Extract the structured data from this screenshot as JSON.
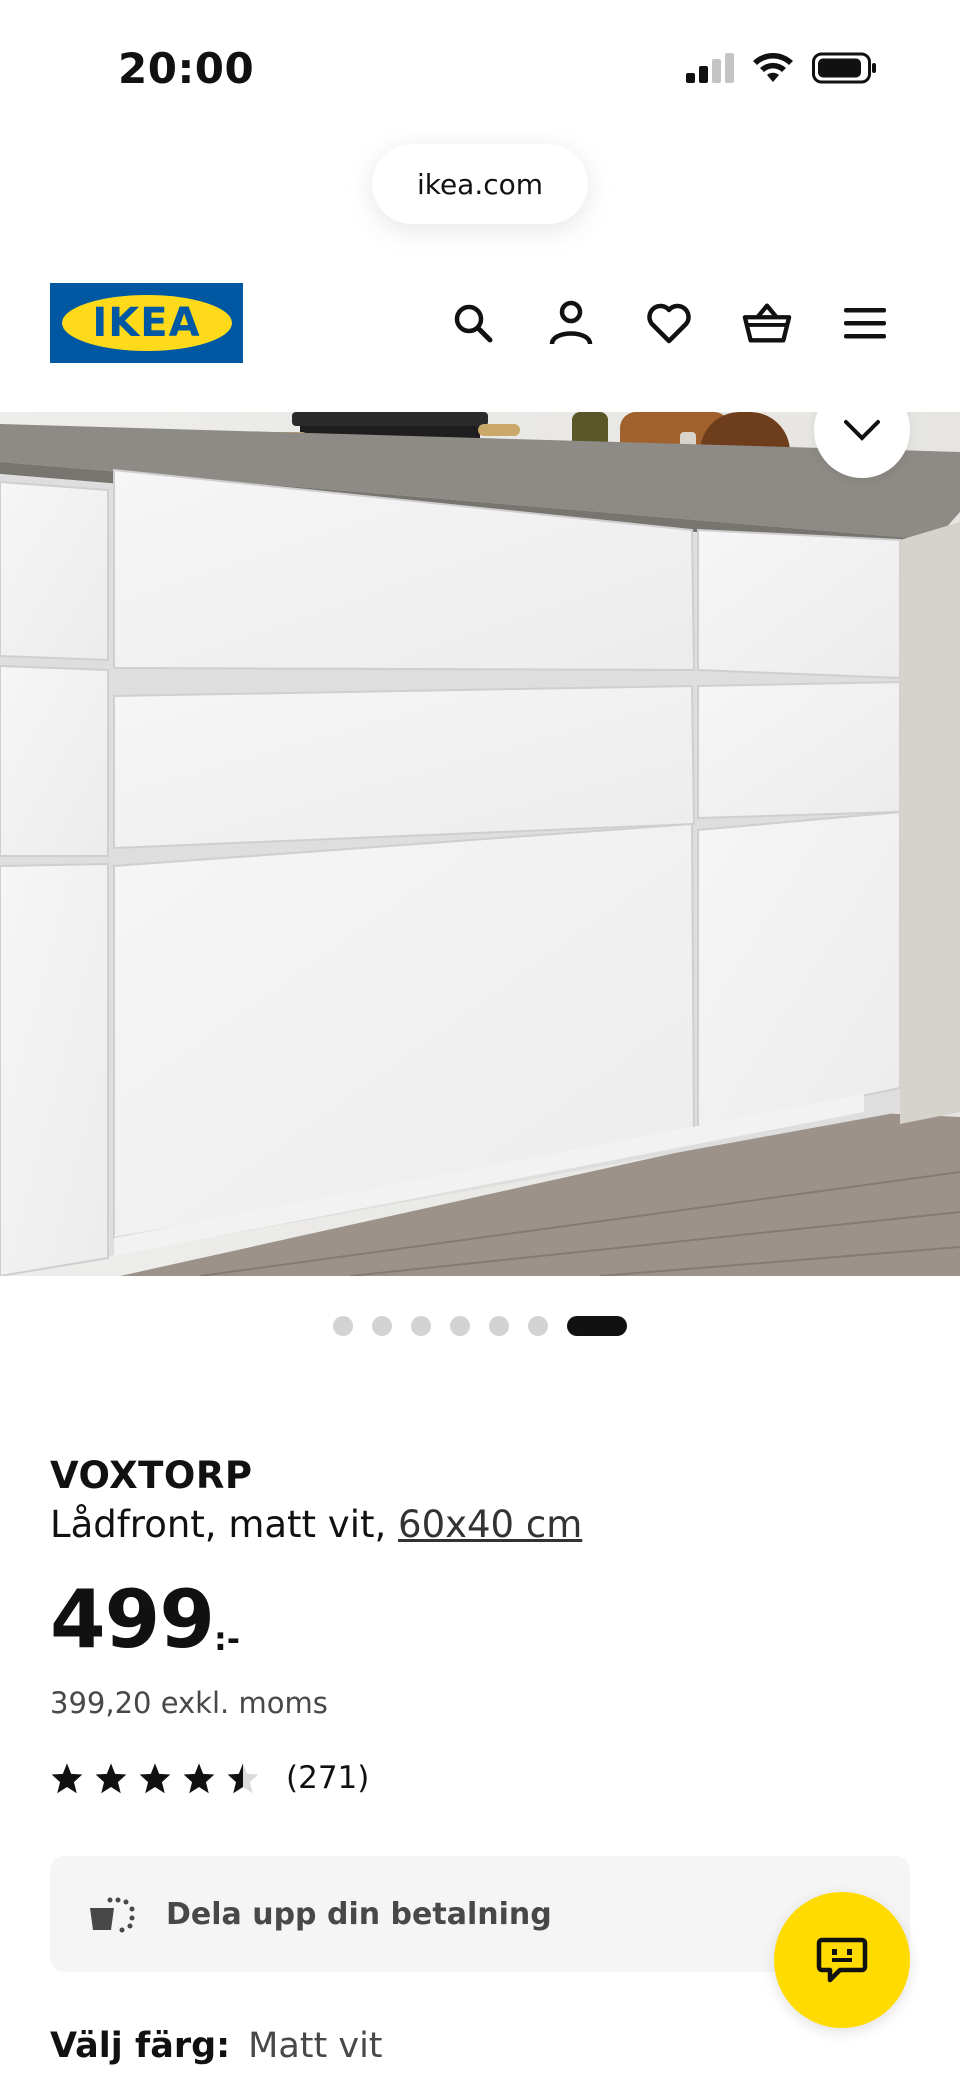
{
  "status_bar": {
    "time": "20:00"
  },
  "browser": {
    "url": "ikea.com"
  },
  "header": {
    "logo_text": "IKEA"
  },
  "carousel": {
    "count": 7,
    "active_index": 6
  },
  "product": {
    "name": "VOXTORP",
    "description": "Lådfront, matt vit,",
    "size": "60x40 cm",
    "price": "499",
    "price_suffix": ":-",
    "price_ex_vat": "399,20 exkl. moms",
    "rating": 4.5,
    "rating_count": "(271)"
  },
  "payment_banner": {
    "label": "Dela upp din betalning"
  },
  "color": {
    "label": "Välj färg:",
    "value": "Matt vit"
  },
  "colors": {
    "ikea_blue": "#0058a3",
    "ikea_yellow": "#ffda1a",
    "chat_yellow": "#ffdb00"
  }
}
